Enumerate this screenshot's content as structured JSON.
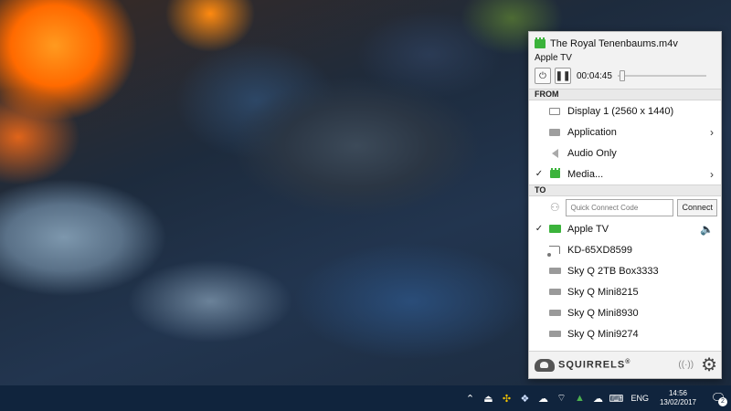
{
  "window": {
    "title": "The Royal Tenenbaums.m4v",
    "subtitle": "Apple TV"
  },
  "playback": {
    "time": "00:04:45",
    "progress": 0.02,
    "power_icon": "power-icon",
    "pause_icon": "pause-icon"
  },
  "from": {
    "label": "FROM",
    "items": [
      {
        "label": "Display 1 (2560 x 1440)",
        "icon": "display-icon",
        "checked": false,
        "submenu": false
      },
      {
        "label": "Application",
        "icon": "application-icon",
        "checked": false,
        "submenu": true
      },
      {
        "label": "Audio Only",
        "icon": "speaker-icon",
        "checked": false,
        "submenu": false
      },
      {
        "label": "Media...",
        "icon": "media-icon",
        "checked": true,
        "submenu": true
      }
    ]
  },
  "to": {
    "label": "TO",
    "quick_connect": {
      "placeholder": "Quick Connect Code",
      "value": "",
      "button_label": "Connect"
    },
    "devices": [
      {
        "label": "Apple TV",
        "icon": "apple-tv-icon",
        "checked": true,
        "playing": true
      },
      {
        "label": "KD-65XD8599",
        "icon": "cast-icon",
        "checked": false,
        "playing": false
      },
      {
        "label": "Sky Q 2TB Box3333",
        "icon": "set-top-box-icon",
        "checked": false,
        "playing": false
      },
      {
        "label": "Sky Q Mini8215",
        "icon": "set-top-box-icon",
        "checked": false,
        "playing": false
      },
      {
        "label": "Sky Q Mini8930",
        "icon": "set-top-box-icon",
        "checked": false,
        "playing": false
      },
      {
        "label": "Sky Q Mini9274",
        "icon": "set-top-box-icon",
        "checked": false,
        "playing": false
      }
    ]
  },
  "footer": {
    "logo_text": "SQUIRRELS",
    "logo_trademark": "®"
  },
  "taskbar": {
    "language": "ENG",
    "time": "14:56",
    "date": "13/02/2017",
    "notification_count": "2"
  },
  "colors": {
    "accent_green": "#3bb33b",
    "taskbar": "#10243d"
  }
}
